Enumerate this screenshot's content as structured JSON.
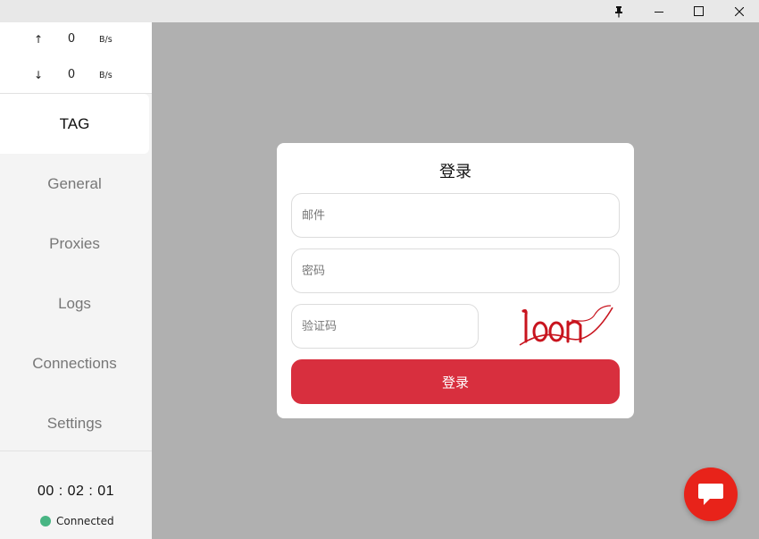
{
  "traffic": {
    "up_arrow": "↑",
    "up_value": "0",
    "up_unit": "B/s",
    "down_arrow": "↓",
    "down_value": "0",
    "down_unit": "B/s"
  },
  "sidebar": {
    "items": [
      {
        "label": "TAG"
      },
      {
        "label": "General"
      },
      {
        "label": "Proxies"
      },
      {
        "label": "Logs"
      },
      {
        "label": "Connections"
      },
      {
        "label": "Settings"
      }
    ],
    "active_index": 0,
    "timer": "00 : 02 : 01",
    "status": "Connected",
    "status_color": "#48b583"
  },
  "login": {
    "title": "登录",
    "email_placeholder": "邮件",
    "password_placeholder": "密码",
    "captcha_placeholder": "验证码",
    "submit_label": "登录",
    "accent_color": "#d82f3e"
  },
  "icons": {
    "pin": "pin-icon",
    "minimize": "minimize-icon",
    "maximize": "maximize-icon",
    "close": "close-icon",
    "chat": "chat-bubble-icon"
  },
  "colors": {
    "chat_button": "#e8231a",
    "overlay": "#b0b0b0"
  }
}
